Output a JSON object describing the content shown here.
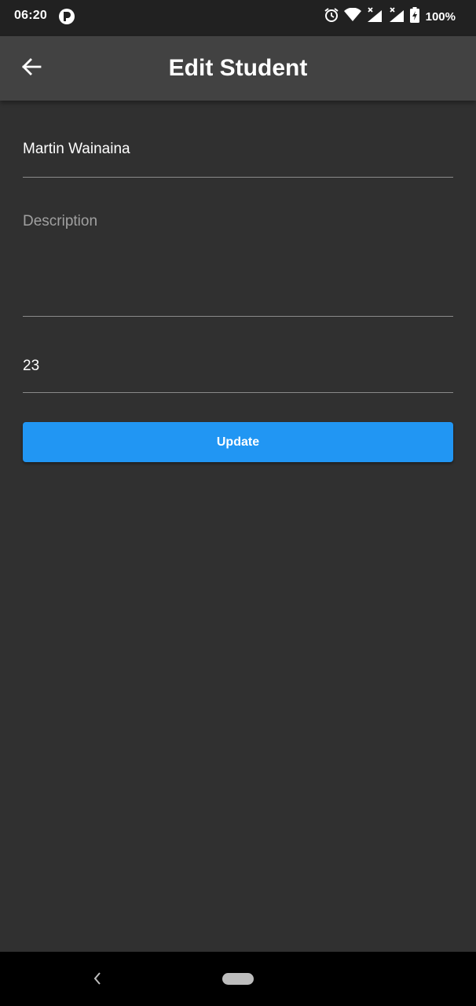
{
  "status_bar": {
    "time": "06:20",
    "battery_percent": "100%",
    "icons": [
      "app-notification-icon",
      "alarm-icon",
      "wifi-icon",
      "signal-no-service-icon",
      "signal-no-service-icon",
      "battery-charging-icon"
    ]
  },
  "app_bar": {
    "title": "Edit Student",
    "back_icon": "arrow-back-icon"
  },
  "form": {
    "name_value": "Martin Wainaina",
    "description_value": "",
    "description_placeholder": "Description",
    "age_value": "23",
    "update_label": "Update"
  },
  "nav_bar": {
    "back_icon": "nav-back-icon",
    "home_icon": "nav-home-pill-icon"
  },
  "colors": {
    "background": "#303030",
    "status_bar": "#212121",
    "app_bar": "#424242",
    "accent": "#2196f3",
    "nav_bar": "#000000"
  }
}
